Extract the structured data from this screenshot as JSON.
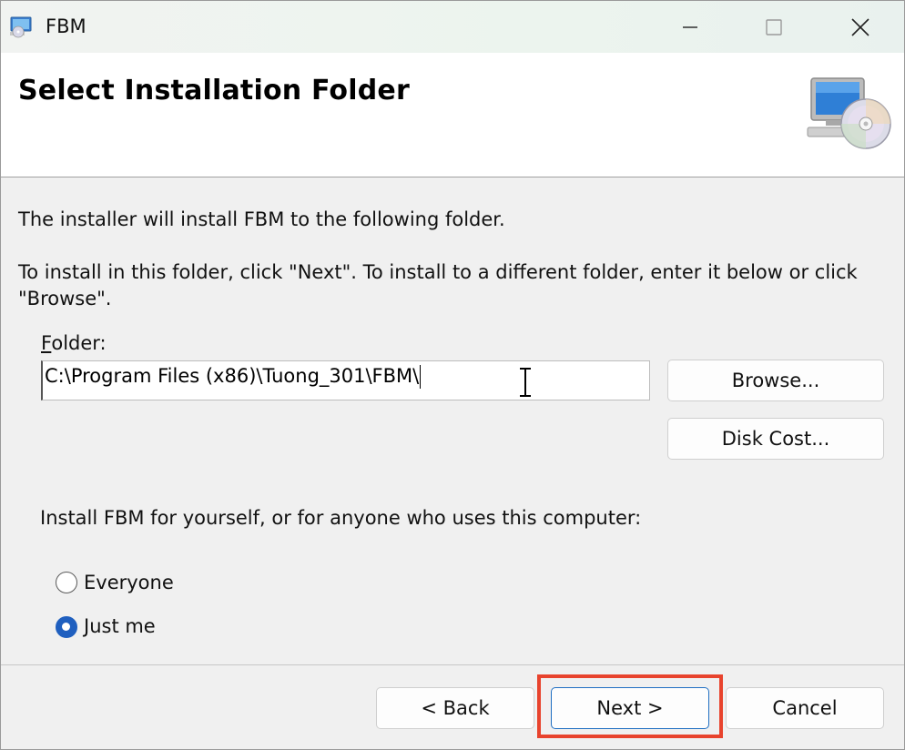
{
  "window": {
    "title": "FBM",
    "minimize_icon": "minimize-icon",
    "maximize_icon": "maximize-icon",
    "close_icon": "close-icon"
  },
  "banner": {
    "title": "Select Installation Folder",
    "graphic_icon": "computer-cd-icon"
  },
  "body": {
    "intro": "The installer will install FBM to the following folder.",
    "instruction_line1": "To install in this folder, click \"Next\". To install to a different folder, enter it below or click",
    "instruction_line2": "\"Browse\".",
    "folder_label": "Folder:",
    "folder_value": "C:\\Program Files (x86)\\Tuong_301\\FBM\\",
    "browse_label": "Browse...",
    "disk_cost_label": "Disk Cost...",
    "install_for_label": "Install FBM for yourself, or for anyone who uses this computer:",
    "options": [
      {
        "label": "Everyone",
        "selected": false
      },
      {
        "label": "Just me",
        "selected": true
      }
    ]
  },
  "footer": {
    "back_label": "< Back",
    "next_label": "Next >",
    "cancel_label": "Cancel"
  },
  "colors": {
    "accent": "#1f5fbf",
    "highlight": "#e8432d"
  }
}
